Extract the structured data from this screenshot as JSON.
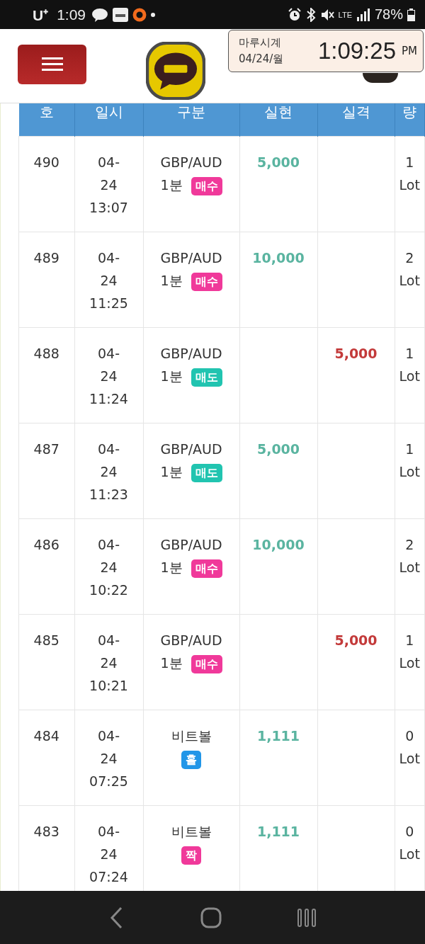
{
  "status_bar": {
    "carrier": "U⁺",
    "time": "1:09",
    "battery": "78%",
    "network": "LTE"
  },
  "clock_widget": {
    "title": "마루시계",
    "date": "04/24/월",
    "time": "1:09:25",
    "ampm": "PM"
  },
  "table": {
    "columns": [
      "호",
      "일시",
      "구분",
      "실현",
      "실격",
      "량"
    ],
    "rows": [
      {
        "no": "490",
        "date": "04-24",
        "time": "13:07",
        "item": "GBP/AUD",
        "period": "1분",
        "badge": {
          "label": "매수",
          "color": "#f0399a"
        },
        "profit": "5,000",
        "loss": "",
        "qty": "1 Lot"
      },
      {
        "no": "489",
        "date": "04-24",
        "time": "11:25",
        "item": "GBP/AUD",
        "period": "1분",
        "badge": {
          "label": "매수",
          "color": "#f0399a"
        },
        "profit": "10,000",
        "loss": "",
        "qty": "2 Lot"
      },
      {
        "no": "488",
        "date": "04-24",
        "time": "11:24",
        "item": "GBP/AUD",
        "period": "1분",
        "badge": {
          "label": "매도",
          "color": "#21c4b0"
        },
        "profit": "",
        "loss": "5,000",
        "qty": "1 Lot"
      },
      {
        "no": "487",
        "date": "04-24",
        "time": "11:23",
        "item": "GBP/AUD",
        "period": "1분",
        "badge": {
          "label": "매도",
          "color": "#21c4b0"
        },
        "profit": "5,000",
        "loss": "",
        "qty": "1 Lot"
      },
      {
        "no": "486",
        "date": "04-24",
        "time": "10:22",
        "item": "GBP/AUD",
        "period": "1분",
        "badge": {
          "label": "매수",
          "color": "#f0399a"
        },
        "profit": "10,000",
        "loss": "",
        "qty": "2 Lot"
      },
      {
        "no": "485",
        "date": "04-24",
        "time": "10:21",
        "item": "GBP/AUD",
        "period": "1분",
        "badge": {
          "label": "매수",
          "color": "#f0399a"
        },
        "profit": "",
        "loss": "5,000",
        "qty": "1 Lot"
      },
      {
        "no": "484",
        "date": "04-24",
        "time": "07:25",
        "item": "비트볼",
        "period": "",
        "badge": {
          "label": "홀",
          "color": "#2196e8"
        },
        "profit": "1,111",
        "loss": "",
        "qty": "0 Lot"
      },
      {
        "no": "483",
        "date": "04-24",
        "time": "07:24",
        "item": "비트볼",
        "period": "",
        "badge": {
          "label": "짝",
          "color": "#f0399a"
        },
        "profit": "1,111",
        "loss": "",
        "qty": "0 Lot"
      }
    ]
  }
}
